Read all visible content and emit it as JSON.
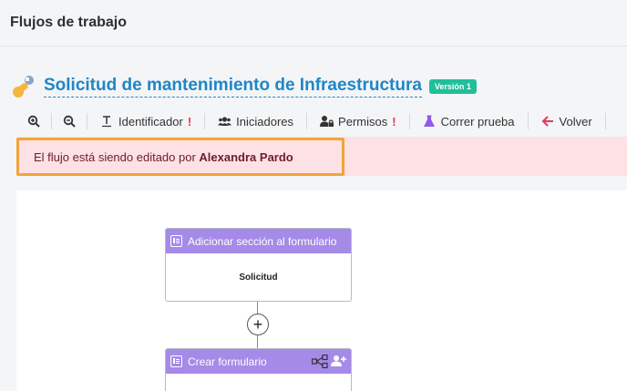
{
  "header": {
    "title": "Flujos de trabajo"
  },
  "flow": {
    "title": "Solicitud de mantenimiento de Infraestructura",
    "version": "Versión 1",
    "icon": "wrench-icon"
  },
  "toolbar": {
    "zoom_in_icon": "zoom-in-icon",
    "zoom_out_icon": "zoom-out-icon",
    "identificador": "Identificador",
    "iniciadores": "Iniciadores",
    "permisos": "Permisos",
    "correr_prueba": "Correr prueba",
    "volver": "Volver",
    "warning_mark": "!"
  },
  "alert": {
    "prefix": "El flujo está siendo editado por",
    "user": "Alexandra Pardo"
  },
  "canvas": {
    "nodes": [
      {
        "title": "Adicionar sección al formulario",
        "body": "Solicitud"
      },
      {
        "title": "Crear formulario",
        "body": ""
      }
    ],
    "add_symbol": "+"
  },
  "colors": {
    "accent": "#1f86c8",
    "badge": "#1fbf9a",
    "node_header": "#a58ae8",
    "alert_bg": "#fde1e5",
    "highlight": "#f2a43a",
    "warning": "#e53946"
  }
}
